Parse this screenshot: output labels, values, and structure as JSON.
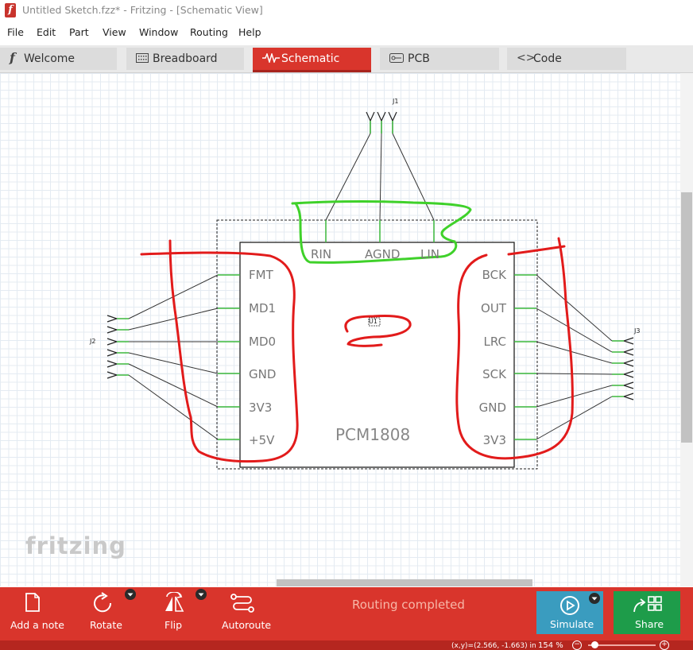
{
  "window": {
    "title": "Untitled Sketch.fzz* - Fritzing - [Schematic View]",
    "app_icon": "f"
  },
  "menu": [
    "File",
    "Edit",
    "Part",
    "View",
    "Window",
    "Routing",
    "Help"
  ],
  "tabs": [
    {
      "label": "Welcome",
      "icon": "fritzing-f-icon"
    },
    {
      "label": "Breadboard",
      "icon": "breadboard-icon"
    },
    {
      "label": "Schematic",
      "icon": "resistor-icon",
      "active": true
    },
    {
      "label": "PCB",
      "icon": "pcb-icon"
    },
    {
      "label": "Code",
      "icon": "code-icon"
    }
  ],
  "schematic": {
    "chip_name": "PCM1808",
    "chip_ref": "U1",
    "left_pins": [
      "FMT",
      "MD1",
      "MD0",
      "GND",
      "3V3",
      "+5V"
    ],
    "right_pins": [
      "BCK",
      "OUT",
      "LRC",
      "SCK",
      "GND",
      "3V3"
    ],
    "top_pins": [
      "RIN",
      "AGND",
      "LIN"
    ],
    "connectors": {
      "top": "J1",
      "left": "J2",
      "right": "J3"
    },
    "watermark": "fritzing",
    "annotation_colors": {
      "red": "#e21b1b",
      "green": "#3fd12a"
    }
  },
  "toolbar": {
    "add_note": "Add a note",
    "rotate": "Rotate",
    "flip": "Flip",
    "autoroute": "Autoroute",
    "status": "Routing completed",
    "simulate": "Simulate",
    "share": "Share"
  },
  "statusbar": {
    "coords": "(x,y)=(2.566, -1.663) in",
    "zoom": "154 %"
  },
  "colors": {
    "accent": "#d9352c",
    "simulate": "#3a9cbf",
    "share": "#1e9c4a"
  }
}
